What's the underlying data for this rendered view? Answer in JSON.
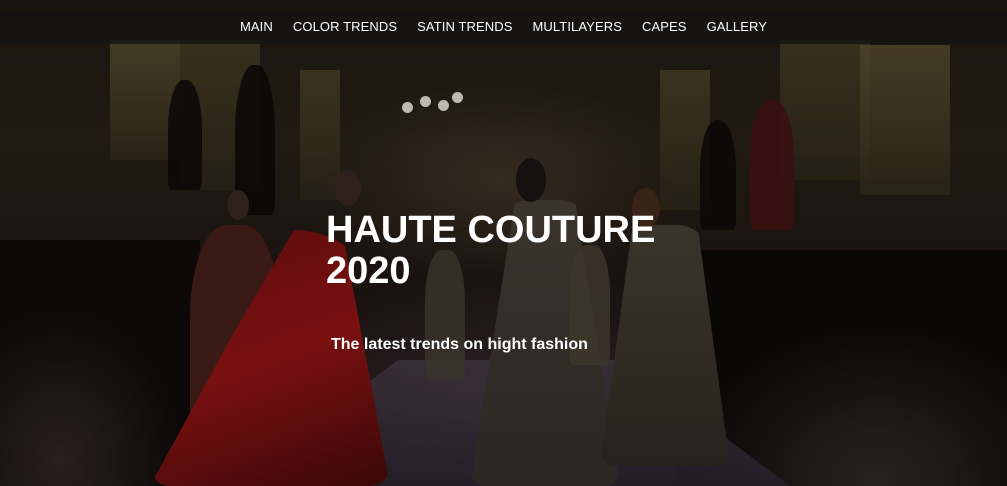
{
  "nav": {
    "items": [
      {
        "label": "MAIN"
      },
      {
        "label": "COLOR TRENDS"
      },
      {
        "label": "SATIN TRENDS"
      },
      {
        "label": "MULTILAYERS"
      },
      {
        "label": "CAPES"
      },
      {
        "label": "GALLERY"
      }
    ]
  },
  "hero": {
    "title_line1": "HAUTE COUTURE",
    "title_line2": "2020",
    "subtitle": "The latest trends on hight fashion"
  }
}
